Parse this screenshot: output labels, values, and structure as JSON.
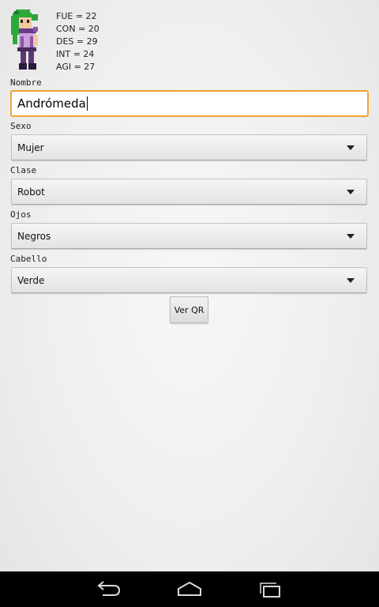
{
  "character": {
    "stats": [
      "FUE = 22",
      "CON = 20",
      "DES = 29",
      "INT = 24",
      "AGI = 27"
    ]
  },
  "form": {
    "name_label": "Nombre",
    "name_value": "Andrómeda",
    "sex_label": "Sexo",
    "sex_value": "Mujer",
    "class_label": "Clase",
    "class_value": "Robot",
    "eyes_label": "Ojos",
    "eyes_value": "Negros",
    "hair_label": "Cabello",
    "hair_value": "Verde",
    "qr_button": "Ver QR"
  },
  "colors": {
    "focus_border": "#f4a233",
    "hair": "#2da83a",
    "navbar": "#000000"
  },
  "icons": {
    "nav": [
      "back-icon",
      "home-icon",
      "recent-apps-icon"
    ],
    "dropdown": "dropdown-arrow-icon"
  }
}
